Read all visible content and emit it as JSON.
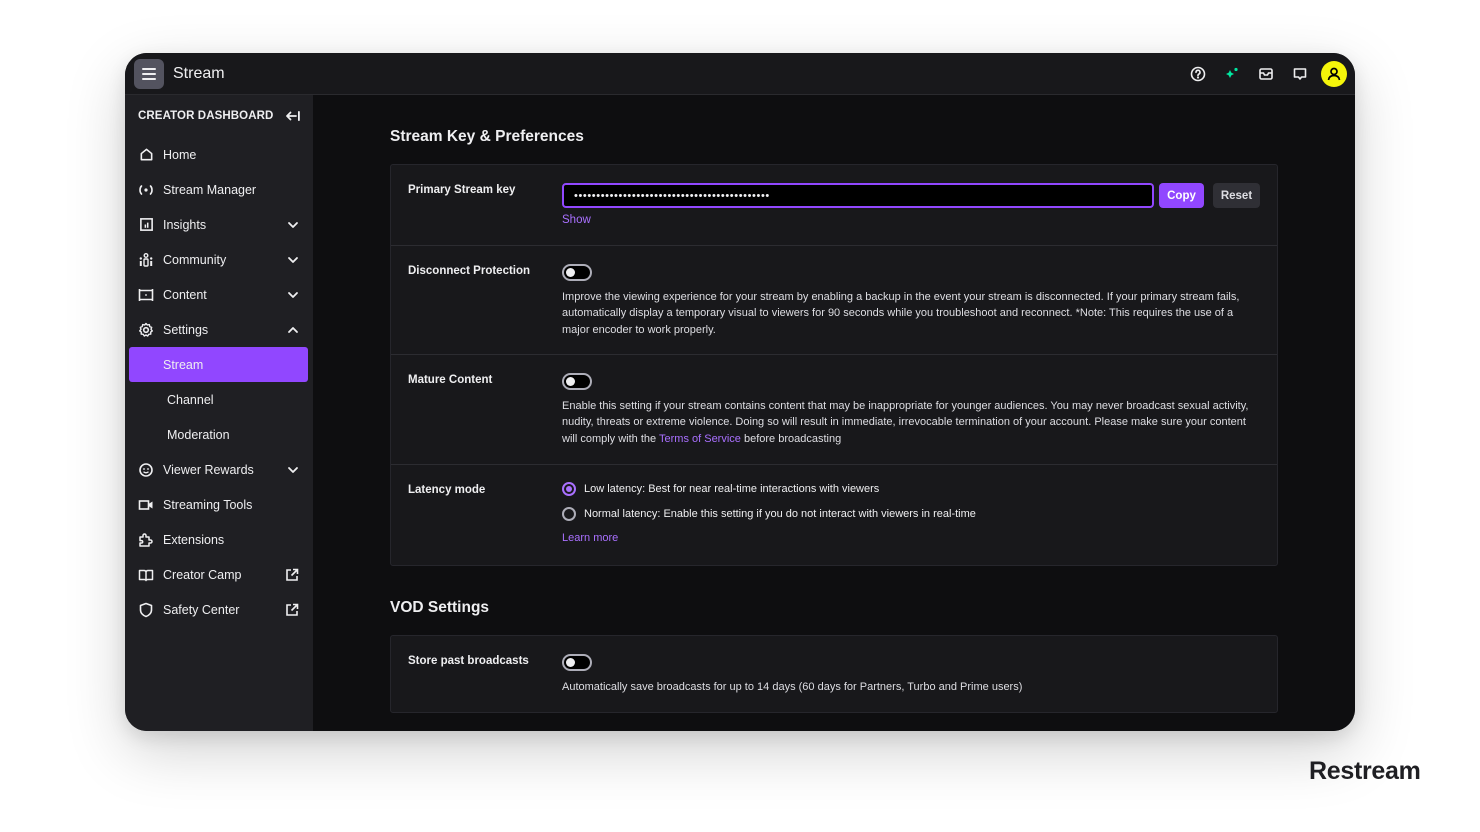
{
  "app": {
    "title": "Stream"
  },
  "topbar": {
    "icons": [
      "help-icon",
      "sparkle-icon",
      "inbox-icon",
      "whispers-icon"
    ],
    "accent_sparkle": "#00e6a0",
    "avatar_color": "#f5f50a"
  },
  "sidebar": {
    "header": "CREATOR DASHBOARD",
    "items": [
      {
        "label": "Home",
        "icon": "home-icon"
      },
      {
        "label": "Stream Manager",
        "icon": "broadcast-icon"
      },
      {
        "label": "Insights",
        "icon": "insights-icon",
        "expandable": true
      },
      {
        "label": "Community",
        "icon": "community-icon",
        "expandable": true
      },
      {
        "label": "Content",
        "icon": "content-icon",
        "expandable": true
      },
      {
        "label": "Settings",
        "icon": "gear-icon",
        "expanded": true
      },
      {
        "label": "Viewer Rewards",
        "icon": "rewards-icon",
        "expandable": true
      },
      {
        "label": "Streaming Tools",
        "icon": "camera-icon"
      },
      {
        "label": "Extensions",
        "icon": "puzzle-icon"
      },
      {
        "label": "Creator Camp",
        "icon": "book-icon",
        "external": true
      },
      {
        "label": "Safety Center",
        "icon": "shield-icon",
        "external": true
      }
    ],
    "settings_sub": [
      {
        "label": "Stream",
        "active": true
      },
      {
        "label": "Channel"
      },
      {
        "label": "Moderation"
      }
    ],
    "active_color": "#9147ff"
  },
  "main": {
    "section1_title": "Stream Key & Preferences",
    "stream_key": {
      "label": "Primary Stream key",
      "value": "••••••••••••••••••••••••••••••••••••••••••••",
      "copy_label": "Copy",
      "reset_label": "Reset",
      "show_label": "Show"
    },
    "disconnect": {
      "label": "Disconnect Protection",
      "enabled": false,
      "description": "Improve the viewing experience for your stream by enabling a backup in the event your stream is disconnected. If your primary stream fails, automatically display a temporary visual to viewers for 90 seconds while you troubleshoot and reconnect. *Note: This requires the use of a major encoder to work properly."
    },
    "mature": {
      "label": "Mature Content",
      "enabled": false,
      "description_before": "Enable this setting if your stream contains content that may be inappropriate for younger audiences. You may never broadcast sexual activity, nudity, threats or extreme violence. Doing so will result in immediate, irrevocable termination of your account. Please make sure your content will comply with the ",
      "link": "Terms of Service",
      "description_after": " before broadcasting"
    },
    "latency": {
      "label": "Latency mode",
      "options": [
        {
          "label": "Low latency: Best for near real-time interactions with viewers",
          "selected": true
        },
        {
          "label": "Normal latency: Enable this setting if you do not interact with viewers in real-time",
          "selected": false
        }
      ],
      "learn_more": "Learn more"
    },
    "section2_title": "VOD Settings",
    "vod": {
      "label": "Store past broadcasts",
      "enabled": false,
      "description": "Automatically save broadcasts for up to 14 days (60 days for Partners, Turbo and Prime users)"
    }
  },
  "watermark": "Restream"
}
